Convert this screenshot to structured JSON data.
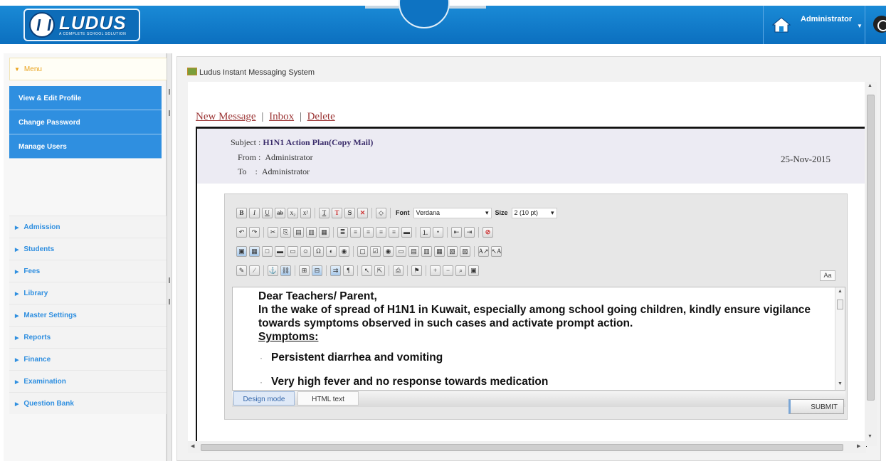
{
  "header": {
    "logo_text": "LUDUS",
    "logo_sub": "A COMPLETE SCHOOL SOLUTION",
    "user_name": "Administrator",
    "caret": "▼"
  },
  "sidebar": {
    "menu_label": "Menu",
    "profile_items": [
      "View & Edit Profile",
      "Change Password",
      "Manage Users"
    ],
    "nav_items": [
      "Admission",
      "Students",
      "Fees",
      "Library",
      "Master Settings",
      "Reports",
      "Finance",
      "Examination",
      "Question Bank"
    ]
  },
  "main": {
    "title": "Ludus Instant Messaging System",
    "links": {
      "new_message": "New Message",
      "inbox": "Inbox",
      "delete": "Delete",
      "separator": "|"
    },
    "mail": {
      "subject_label": "Subject :",
      "subject": "H1N1 Action Plan(Copy Mail)",
      "from_label": "From :",
      "from": "Administrator",
      "to_label": "To",
      "to_sep": ":",
      "to": "Administrator",
      "date": "25-Nov-2015"
    },
    "editor": {
      "font_label": "Font",
      "font_value": "Verdana",
      "size_label": "Size",
      "size_value": "2 (10 pt)",
      "aa_label": "Aa",
      "body": {
        "greeting": "Dear Teachers/ Parent,",
        "paragraph": "In the wake of spread of H1N1 in Kuwait, especially among school going children, kindly ensure vigilance towards symptoms observed in such cases and activate prompt action.",
        "symptoms_heading": "Symptoms:",
        "bullets": [
          "Persistent diarrhea and vomiting",
          "Very high fever and no response towards medication"
        ]
      },
      "tabs": [
        "Design mode",
        "HTML text"
      ],
      "submit_label": "SUBMIT"
    }
  }
}
